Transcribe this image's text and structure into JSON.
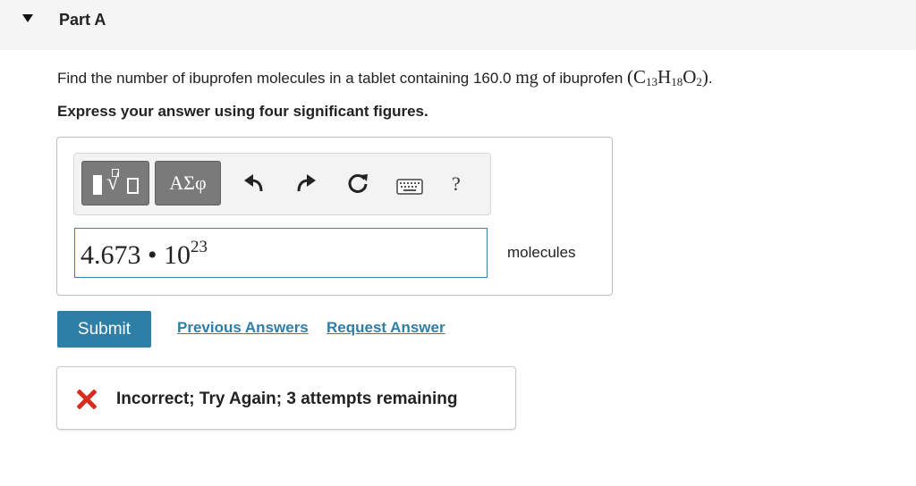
{
  "part": {
    "title": "Part A",
    "caret_icon": "caret-down-icon"
  },
  "question": {
    "text_before": "Find the number of ibuprofen molecules in a tablet containing 160.0 ",
    "unit_mg": "mg",
    "text_mid": " of ibuprofen ",
    "formula": {
      "open": "(",
      "c": "C",
      "c_n": "13",
      "h": "H",
      "h_n": "18",
      "o": "O",
      "o_n": "2",
      "close": ")"
    },
    "text_end": "."
  },
  "instruction": "Express your answer using four significant figures.",
  "toolbar": {
    "template_icon": "templates-icon",
    "symbols_label": "ΑΣφ",
    "undo_icon": "undo-icon",
    "redo_icon": "redo-icon",
    "reset_icon": "reset-icon",
    "keyboard_icon": "keyboard-icon",
    "help_label": "?"
  },
  "answer": {
    "mantissa": "4.673",
    "operator": "•",
    "base": "10",
    "exponent": "23",
    "unit": "molecules"
  },
  "actions": {
    "submit_label": "Submit",
    "previous_answers_label": "Previous Answers",
    "request_answer_label": "Request Answer"
  },
  "feedback": {
    "text": "Incorrect; Try Again; 3 attempts remaining",
    "icon": "x-icon",
    "icon_color": "#d62d20"
  },
  "colors": {
    "accent": "#2e7fa8",
    "header_bg": "#f5f5f5",
    "input_border": "#3a7fa8"
  }
}
